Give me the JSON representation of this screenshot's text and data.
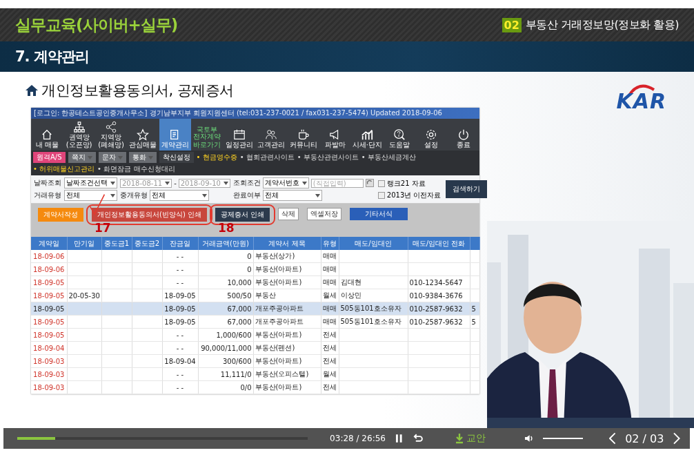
{
  "course": {
    "title": "실무교육(사이버+실무)",
    "chapter_number": "02",
    "chapter_title": "부동산 거래정보망(정보화 활용)"
  },
  "section": {
    "title": "7. 계약관리"
  },
  "slide": {
    "heading": "개인정보활용동의서, 공제증서",
    "logo": "KAR",
    "app": {
      "title_bar": "[로그인: 한공테스트공인중개사무소]  경기남부지부 회원지원센터 (tel:031-237-0021 / fax031-237-5474)  Updated 2018-09-06",
      "toolbar": [
        {
          "label": "내 매물",
          "kind": "icon",
          "selected": false
        },
        {
          "label": "권역망(오픈망)",
          "kind": "icon",
          "selected": false
        },
        {
          "label": "지역망(폐쇄망)",
          "kind": "icon",
          "selected": false
        },
        {
          "label": "관심매물",
          "kind": "icon",
          "selected": false
        },
        {
          "label": "계약관리",
          "kind": "icon",
          "selected": true
        },
        {
          "label": "국토부 전자계약",
          "sublabel": "바로가기",
          "kind": "text",
          "selected": false
        },
        {
          "label": "일정관리",
          "kind": "icon",
          "selected": false
        },
        {
          "label": "고객관리",
          "kind": "icon",
          "selected": false
        },
        {
          "label": "커뮤니티",
          "kind": "icon",
          "selected": false
        },
        {
          "label": "파발마",
          "kind": "icon",
          "selected": false
        },
        {
          "label": "시세·단지",
          "kind": "icon",
          "selected": false
        },
        {
          "label": "도움말",
          "kind": "icon",
          "selected": false
        },
        {
          "label": "설정",
          "kind": "icon",
          "selected": false
        },
        {
          "label": "종료",
          "kind": "icon",
          "selected": false
        }
      ],
      "quick_buttons": [
        {
          "label": "원격A/S",
          "kind": "pink"
        },
        {
          "label": "쪽지",
          "kind": "grey"
        },
        {
          "label": "문자",
          "kind": "grey"
        },
        {
          "label": "통화",
          "kind": "grey"
        },
        {
          "label": "착신설정",
          "kind": "plain"
        }
      ],
      "links": [
        {
          "label": "• 현금영수증",
          "highlight": true
        },
        {
          "label": "• 협회관련사이트",
          "highlight": false
        },
        {
          "label": "• 부동산관련사이트",
          "highlight": false
        },
        {
          "label": "• 부동산세금계산",
          "highlight": false
        },
        {
          "label": "• 허위매물신고관리",
          "highlight": true
        },
        {
          "label": "• 화면잠금",
          "highlight": false
        },
        {
          "label": "매수신청대리",
          "highlight": false
        }
      ],
      "search_form": {
        "date_label": "날짜조회",
        "date_condition": "날짜조건선택",
        "date_from": "2018-08-11",
        "date_separator": "-",
        "date_to": "2018-09-10",
        "condition_label": "조회조건",
        "condition": "계약서번호",
        "keyword_placeholder": "(직접입력)",
        "deal_type_label": "거래유형",
        "deal_type": "전체",
        "broker_type_label": "중개유형",
        "broker_type": "전체",
        "done_label": "완료여부",
        "done": "전체",
        "checkboxes": [
          {
            "label": "랭크21 자료",
            "checked": false
          },
          {
            "label": "2013년 이전자료",
            "checked": false
          }
        ],
        "search_button": "검색하기"
      },
      "actions": [
        {
          "label": "계약서작성",
          "kind": "orange"
        },
        {
          "label": "개인정보활용동의서(빈양식) 인쇄",
          "kind": "red",
          "annotation": "17",
          "checkmark": true
        },
        {
          "label": "공제증서 인쇄",
          "kind": "dark",
          "annotation": "18",
          "checkmark": false
        },
        {
          "label": "삭제",
          "kind": "plain"
        },
        {
          "label": "엑셀저장",
          "kind": "plain"
        },
        {
          "label": "기타서식",
          "kind": "blue"
        }
      ],
      "table": {
        "columns": [
          "계약일",
          "만기일",
          "중도금1",
          "중도금2",
          "잔금일",
          "거래금액(만원)",
          "계약서 제목",
          "유형",
          "매도/임대인",
          "매도/임대인 전화"
        ],
        "rows": [
          {
            "selected": false,
            "cells": [
              "18-09-06",
              null,
              null,
              null,
              "- -",
              "0",
              "부동산(상가)",
              "매매",
              null,
              null
            ]
          },
          {
            "selected": false,
            "cells": [
              "18-09-06",
              null,
              null,
              null,
              "- -",
              "0",
              "부동산(아파트)",
              "매매",
              null,
              null
            ]
          },
          {
            "selected": false,
            "cells": [
              "18-09-05",
              null,
              null,
              null,
              "- -",
              "10,000",
              "부동산(아파트)",
              "매매",
              "김대현",
              "010-1234-5647"
            ]
          },
          {
            "selected": false,
            "cells": [
              "18-09-05",
              "20-05-30",
              null,
              null,
              "18-09-05",
              "500/50",
              "부동산",
              "월세",
              "이상민",
              "010-9384-3676"
            ]
          },
          {
            "selected": true,
            "cells": [
              "18-09-05",
              null,
              null,
              null,
              "18-09-05",
              "67,000",
              "개포주공아파트",
              "매매",
              "505동101호소유자",
              "010-2587-9632",
              "5"
            ]
          },
          {
            "selected": false,
            "cells": [
              "18-09-05",
              null,
              null,
              null,
              "18-09-05",
              "67,000",
              "개포주공아파트",
              "매매",
              "505동101호소유자",
              "010-2587-9632",
              "5"
            ]
          },
          {
            "selected": false,
            "cells": [
              "18-09-05",
              null,
              null,
              null,
              "- -",
              "1,000/600",
              "부동산(아파트)",
              "전세",
              null,
              null
            ]
          },
          {
            "selected": false,
            "cells": [
              "18-09-04",
              null,
              null,
              null,
              "- -",
              "90,000/11,000",
              "부동산(펜션)",
              "전세",
              null,
              null
            ]
          },
          {
            "selected": false,
            "cells": [
              "18-09-03",
              null,
              null,
              null,
              "18-09-04",
              "300/600",
              "부동산(아파트)",
              "전세",
              null,
              null
            ]
          },
          {
            "selected": false,
            "cells": [
              "18-09-03",
              null,
              null,
              null,
              "- -",
              "11,111/0",
              "부동산(오피스텔)",
              "월세",
              null,
              null
            ]
          },
          {
            "selected": false,
            "cells": [
              "18-09-03",
              null,
              null,
              null,
              "- -",
              "0/0",
              "부동산(아파트)",
              "전세",
              null,
              null
            ]
          }
        ]
      }
    }
  },
  "player": {
    "progress": {
      "level": 0.13
    },
    "time": "03:28 / 26:56",
    "handout": "교안",
    "volume": {
      "level": 1
    },
    "page": "02 / 03"
  }
}
